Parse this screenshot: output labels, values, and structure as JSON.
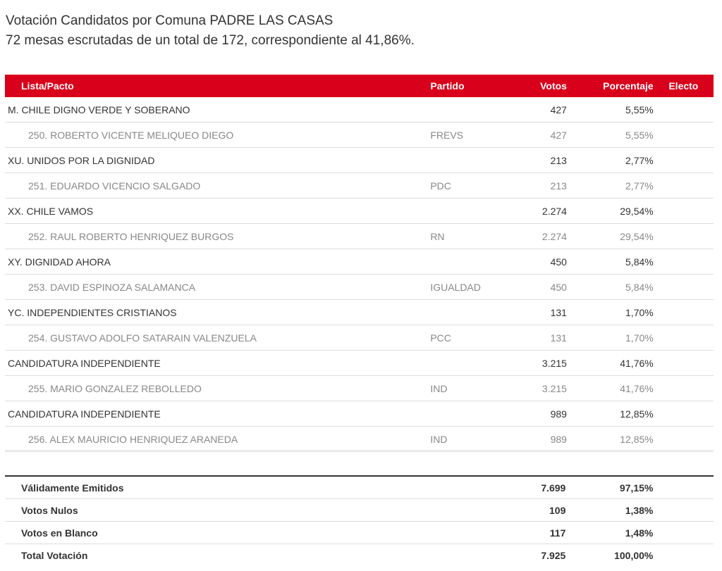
{
  "header": {
    "title": "Votación Candidatos por Comuna PADRE LAS CASAS",
    "subtitle": "72 mesas escrutadas de un total de 172, correspondiente al 41,86%."
  },
  "table": {
    "columns": {
      "lista": "Lista/Pacto",
      "partido": "Partido",
      "votos": "Votos",
      "porcentaje": "Porcentaje",
      "electo": "Electo"
    },
    "rows": [
      {
        "type": "pacto",
        "lista": "M. CHILE DIGNO VERDE Y SOBERANO",
        "partido": "",
        "votos": "427",
        "porcentaje": "5,55%",
        "electo": ""
      },
      {
        "type": "candidate",
        "lista": "250. ROBERTO VICENTE MELIQUEO DIEGO",
        "partido": "FREVS",
        "votos": "427",
        "porcentaje": "5,55%",
        "electo": ""
      },
      {
        "type": "pacto",
        "lista": "XU. UNIDOS POR LA DIGNIDAD",
        "partido": "",
        "votos": "213",
        "porcentaje": "2,77%",
        "electo": ""
      },
      {
        "type": "candidate",
        "lista": "251. EDUARDO VICENCIO SALGADO",
        "partido": "PDC",
        "votos": "213",
        "porcentaje": "2,77%",
        "electo": ""
      },
      {
        "type": "pacto",
        "lista": "XX. CHILE VAMOS",
        "partido": "",
        "votos": "2.274",
        "porcentaje": "29,54%",
        "electo": ""
      },
      {
        "type": "candidate",
        "lista": "252. RAUL ROBERTO HENRIQUEZ BURGOS",
        "partido": "RN",
        "votos": "2.274",
        "porcentaje": "29,54%",
        "electo": ""
      },
      {
        "type": "pacto",
        "lista": "XY. DIGNIDAD AHORA",
        "partido": "",
        "votos": "450",
        "porcentaje": "5,84%",
        "electo": ""
      },
      {
        "type": "candidate",
        "lista": "253. DAVID ESPINOZA SALAMANCA",
        "partido": "IGUALDAD",
        "votos": "450",
        "porcentaje": "5,84%",
        "electo": ""
      },
      {
        "type": "pacto",
        "lista": "YC. INDEPENDIENTES CRISTIANOS",
        "partido": "",
        "votos": "131",
        "porcentaje": "1,70%",
        "electo": ""
      },
      {
        "type": "candidate",
        "lista": "254. GUSTAVO ADOLFO SATARAIN VALENZUELA",
        "partido": "PCC",
        "votos": "131",
        "porcentaje": "1,70%",
        "electo": ""
      },
      {
        "type": "pacto",
        "lista": "CANDIDATURA INDEPENDIENTE",
        "partido": "",
        "votos": "3.215",
        "porcentaje": "41,76%",
        "electo": ""
      },
      {
        "type": "candidate",
        "lista": "255. MARIO GONZALEZ REBOLLEDO",
        "partido": "IND",
        "votos": "3.215",
        "porcentaje": "41,76%",
        "electo": ""
      },
      {
        "type": "pacto",
        "lista": "CANDIDATURA INDEPENDIENTE",
        "partido": "",
        "votos": "989",
        "porcentaje": "12,85%",
        "electo": ""
      },
      {
        "type": "candidate",
        "lista": "256. ALEX MAURICIO HENRIQUEZ ARANEDA",
        "partido": "IND",
        "votos": "989",
        "porcentaje": "12,85%",
        "electo": ""
      }
    ]
  },
  "totals": [
    {
      "label": "Válidamente Emitidos",
      "votos": "7.699",
      "porcentaje": "97,15%"
    },
    {
      "label": "Votos Nulos",
      "votos": "109",
      "porcentaje": "1,38%"
    },
    {
      "label": "Votos en Blanco",
      "votos": "117",
      "porcentaje": "1,48%"
    },
    {
      "label": "Total Votación",
      "votos": "7.925",
      "porcentaje": "100,00%"
    }
  ],
  "colors": {
    "header_bg": "#d9001b",
    "header_text": "#ffffff",
    "candidate_text": "#888888",
    "pacto_text": "#333333"
  }
}
